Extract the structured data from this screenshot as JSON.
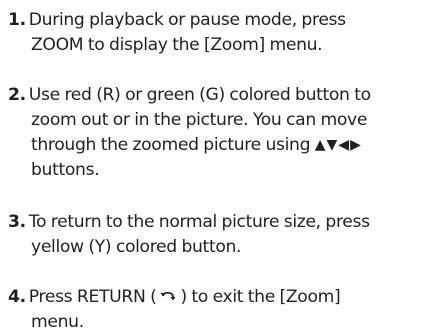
{
  "steps": [
    {
      "number": "1.",
      "lines": [
        "During playback or pause mode, press",
        "ZOOM to display the [Zoom] menu."
      ]
    },
    {
      "number": "2.",
      "lines": [
        "Use red (R) or green (G) colored button to",
        "zoom out or in the picture. You can move",
        "through the zoomed picture using",
        "buttons."
      ],
      "arrow_glyphs": "▲▼◀▶",
      "arrow_icon": "direction-arrows-icon"
    },
    {
      "number": "3.",
      "lines": [
        "To return to the normal picture size, press",
        "yellow (Y) colored button."
      ]
    },
    {
      "number": "4.",
      "lines": [
        "Press RETURN (",
        ") to exit the [Zoom]",
        "menu."
      ],
      "return_icon": "return-icon"
    }
  ]
}
